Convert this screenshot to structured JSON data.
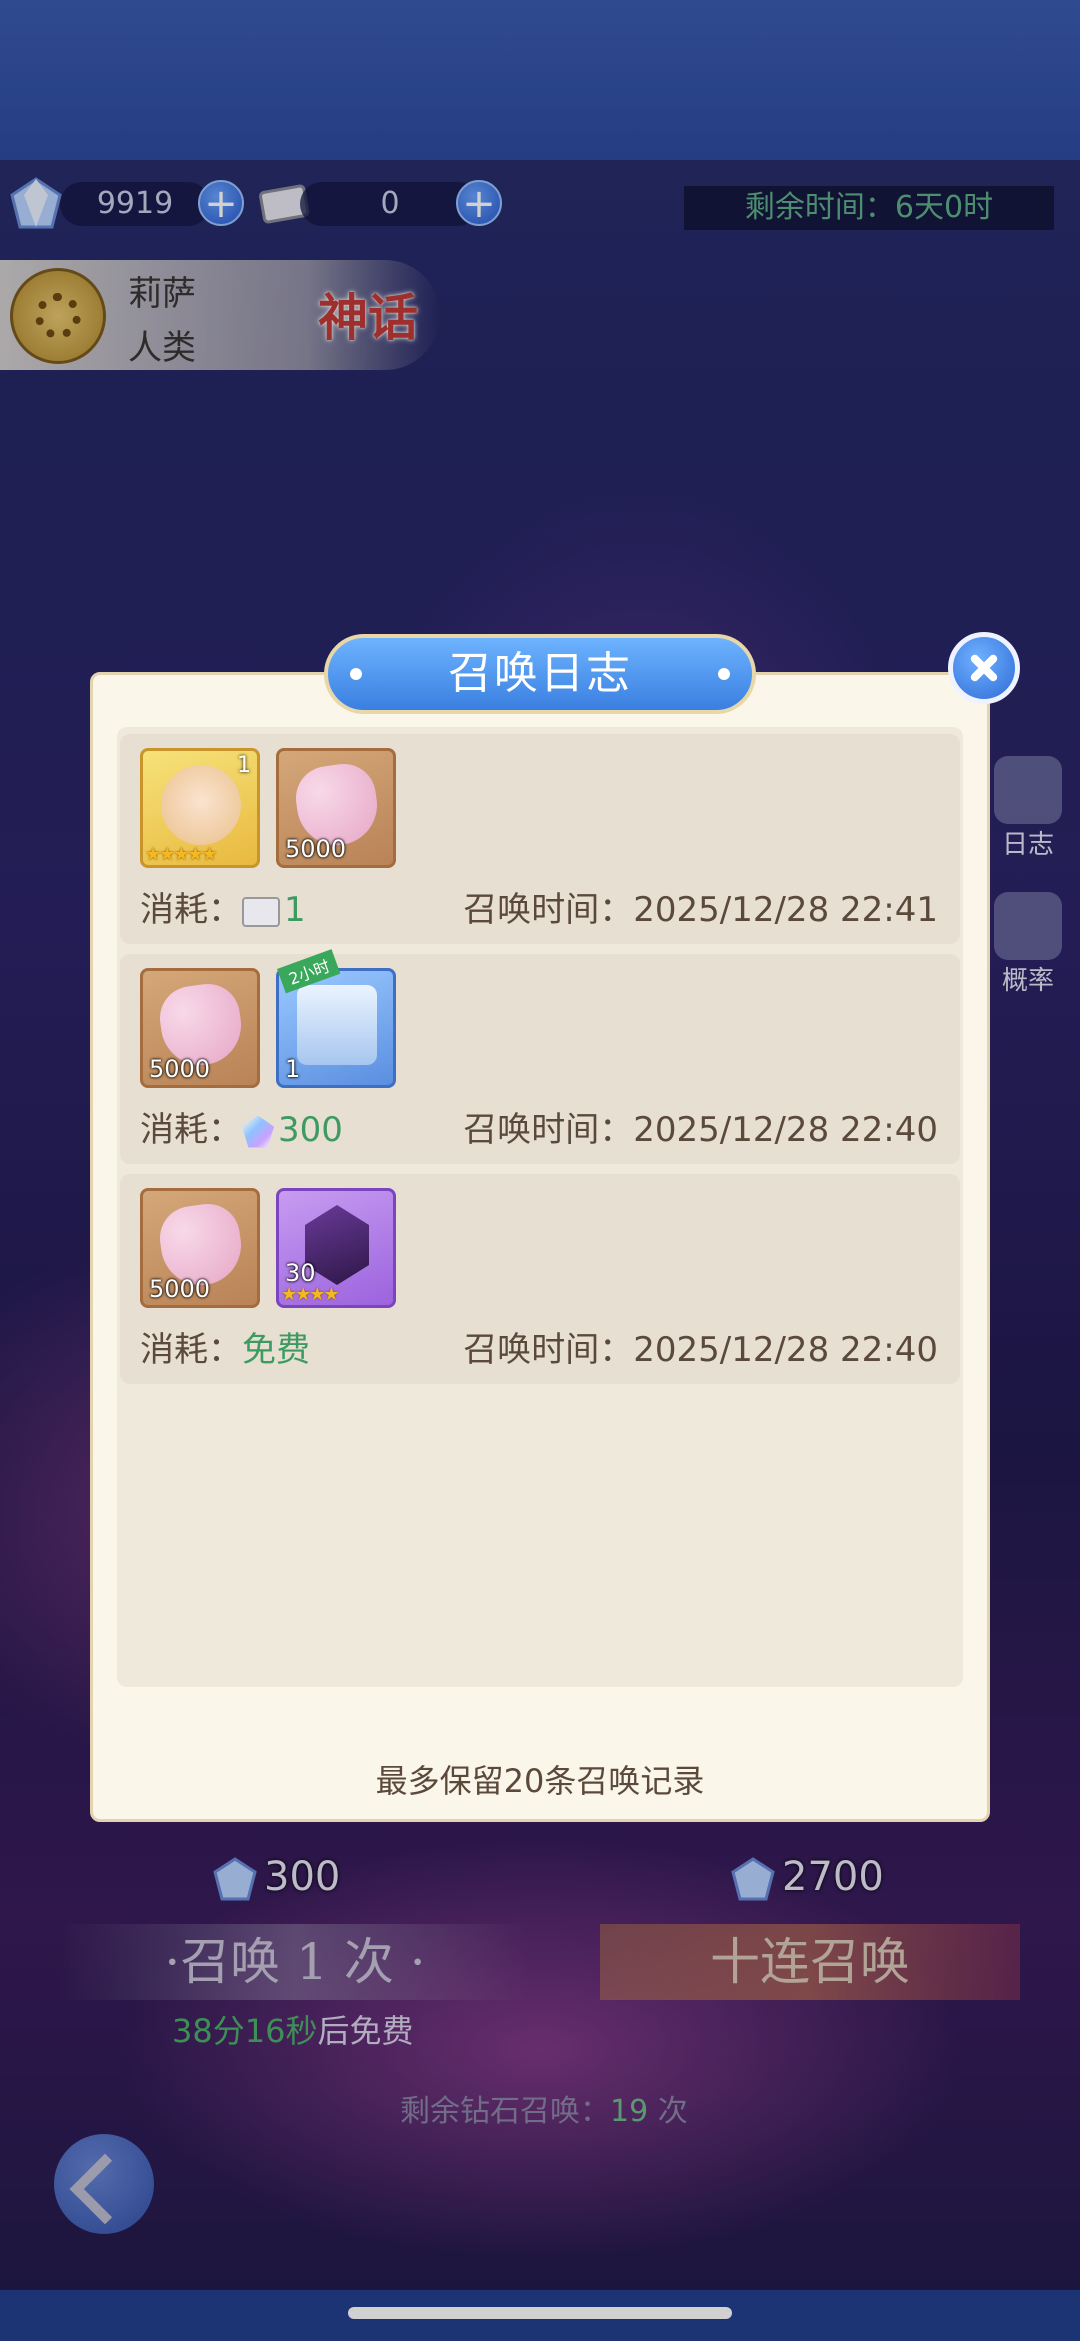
{
  "currency": {
    "gems": "9919",
    "tickets": "0",
    "remaining_time": "剩余时间：6天0时"
  },
  "hero": {
    "name": "莉萨",
    "race": "人类",
    "rarity": "神话"
  },
  "side_buttons": [
    {
      "label": "日志",
      "icon": "log-icon"
    },
    {
      "label": "概率",
      "icon": "dice-icon"
    }
  ],
  "summon": {
    "single_cost": "300",
    "ten_cost": "2700",
    "single_label": "·召唤 1 次 ·",
    "ten_label": "十连召唤",
    "free_timer_value": "38分16秒",
    "free_timer_suffix": "后免费",
    "remaining_prefix": "剩余钻石召唤：",
    "remaining_count": "19",
    "remaining_suffix": " 次"
  },
  "dialog": {
    "title": "召唤日志",
    "cost_label": "消耗：",
    "time_label": "召唤时间：",
    "records": [
      {
        "items": [
          {
            "type": "hero-card",
            "qty": "1",
            "stars": "★★★★★"
          },
          {
            "type": "exp-heart",
            "qty": "5000"
          }
        ],
        "cost": "1",
        "cost_icon": "ticket-icon",
        "time": "2025/12/28 22:41"
      },
      {
        "items": [
          {
            "type": "exp-heart",
            "qty": "5000"
          },
          {
            "type": "chest",
            "qty": "1",
            "badge": "2小时"
          }
        ],
        "cost": "300",
        "cost_icon": "gem-icon",
        "time": "2025/12/28 22:40"
      },
      {
        "items": [
          {
            "type": "exp-heart",
            "qty": "5000"
          },
          {
            "type": "shard",
            "qty": "30",
            "stars": "★★★★"
          }
        ],
        "cost": "免费",
        "cost_icon": "",
        "time": "2025/12/28 22:40"
      }
    ],
    "footer": "最多保留20条召唤记录"
  }
}
